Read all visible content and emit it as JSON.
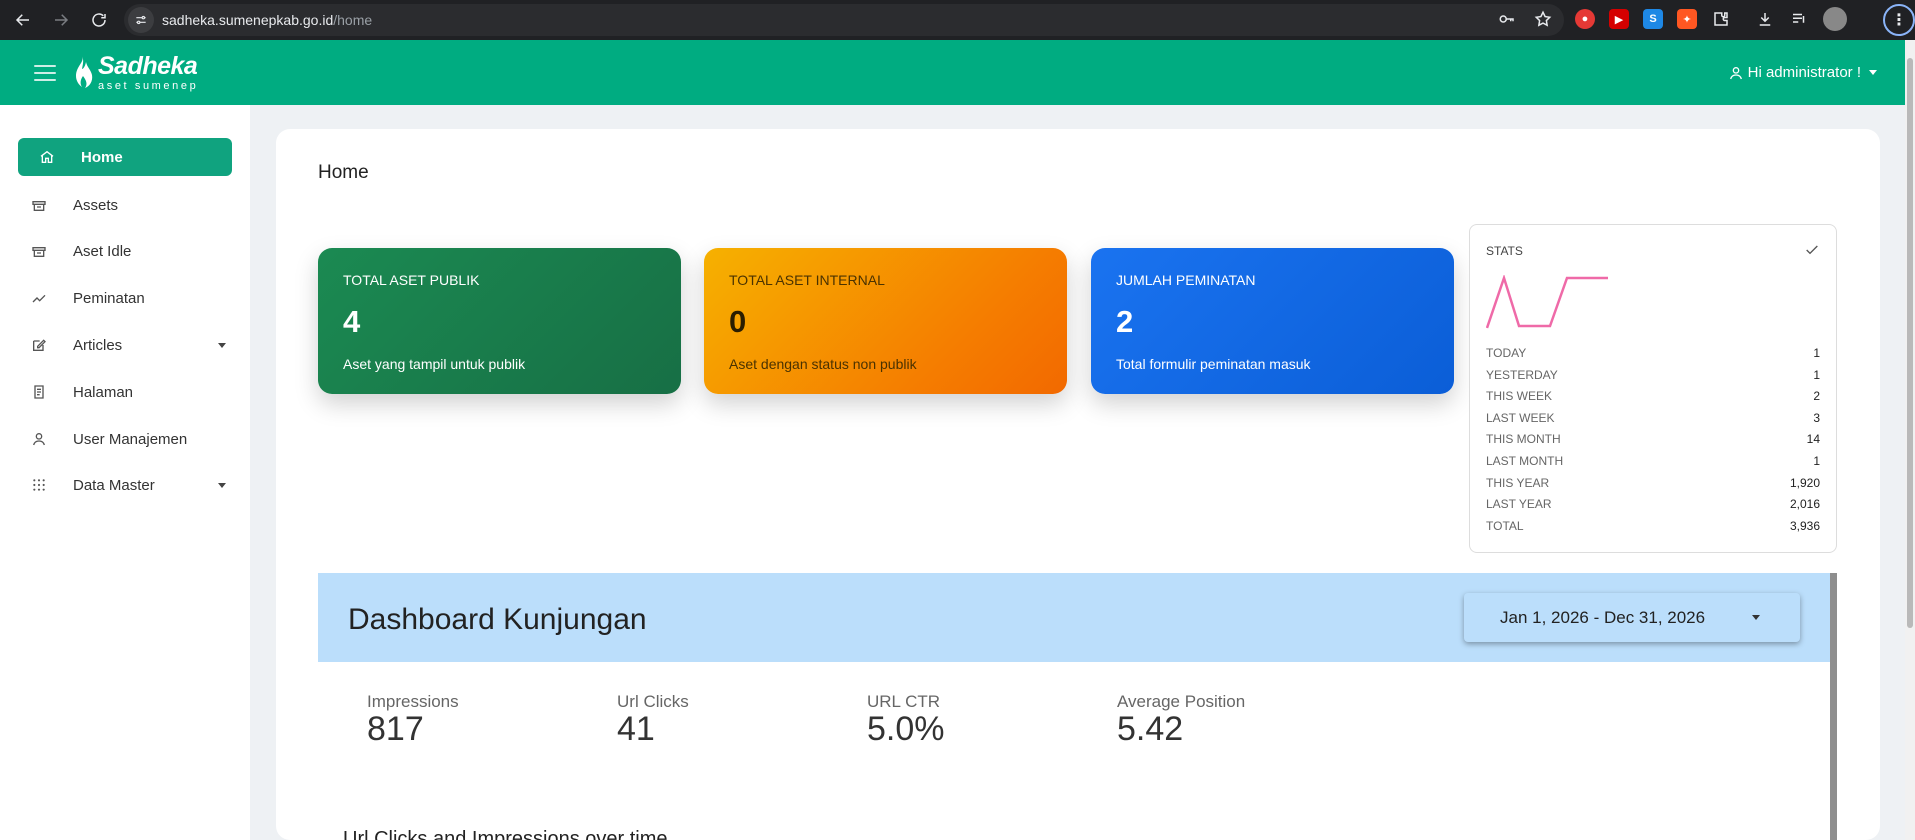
{
  "browser": {
    "url_host": "sadheka.sumenepkab.go.id",
    "url_path": "/home"
  },
  "header": {
    "logo_name": "Sadheka",
    "logo_sub": "aset sumenep",
    "user_greeting": "Hi administrator !"
  },
  "sidebar": {
    "items": [
      {
        "label": "Home",
        "icon": "home-icon"
      },
      {
        "label": "Assets",
        "icon": "box-icon"
      },
      {
        "label": "Aset Idle",
        "icon": "box-icon"
      },
      {
        "label": "Peminatan",
        "icon": "trend-icon"
      },
      {
        "label": "Articles",
        "icon": "edit-icon"
      },
      {
        "label": "Halaman",
        "icon": "page-icon"
      },
      {
        "label": "User Manajemen",
        "icon": "user-icon"
      },
      {
        "label": "Data Master",
        "icon": "grid-icon"
      }
    ]
  },
  "page": {
    "title": "Home"
  },
  "cards": [
    {
      "label": "TOTAL ASET PUBLIK",
      "value": "4",
      "desc": "Aset yang tampil untuk publik"
    },
    {
      "label": "TOTAL ASET INTERNAL",
      "value": "0",
      "desc": "Aset dengan status non publik"
    },
    {
      "label": "JUMLAH PEMINATAN",
      "value": "2",
      "desc": "Total formulir peminatan masuk"
    }
  ],
  "stats": {
    "title": "STATS",
    "rows": [
      {
        "k": "TODAY",
        "v": "1"
      },
      {
        "k": "YESTERDAY",
        "v": "1"
      },
      {
        "k": "THIS WEEK",
        "v": "2"
      },
      {
        "k": "LAST WEEK",
        "v": "3"
      },
      {
        "k": "THIS MONTH",
        "v": "14"
      },
      {
        "k": "LAST MONTH",
        "v": "1"
      },
      {
        "k": "THIS YEAR",
        "v": "1,920"
      },
      {
        "k": "LAST YEAR",
        "v": "2,016"
      },
      {
        "k": "TOTAL",
        "v": "3,936"
      }
    ],
    "sparkline_color": "#ef6aa8"
  },
  "dashboard": {
    "title": "Dashboard Kunjungan",
    "date_range": "Jan 1, 2026 - Dec 31, 2026",
    "metrics": [
      {
        "label": "Impressions",
        "value": "817"
      },
      {
        "label": "Url Clicks",
        "value": "41"
      },
      {
        "label": "URL CTR",
        "value": "5.0%"
      },
      {
        "label": "Average Position",
        "value": "5.42"
      }
    ],
    "chart_title": "Url Clicks and Impressions over time"
  },
  "colors": {
    "brand": "#00ac81",
    "active_nav": "#10a37f",
    "dashboard_header": "#bbdefb"
  }
}
